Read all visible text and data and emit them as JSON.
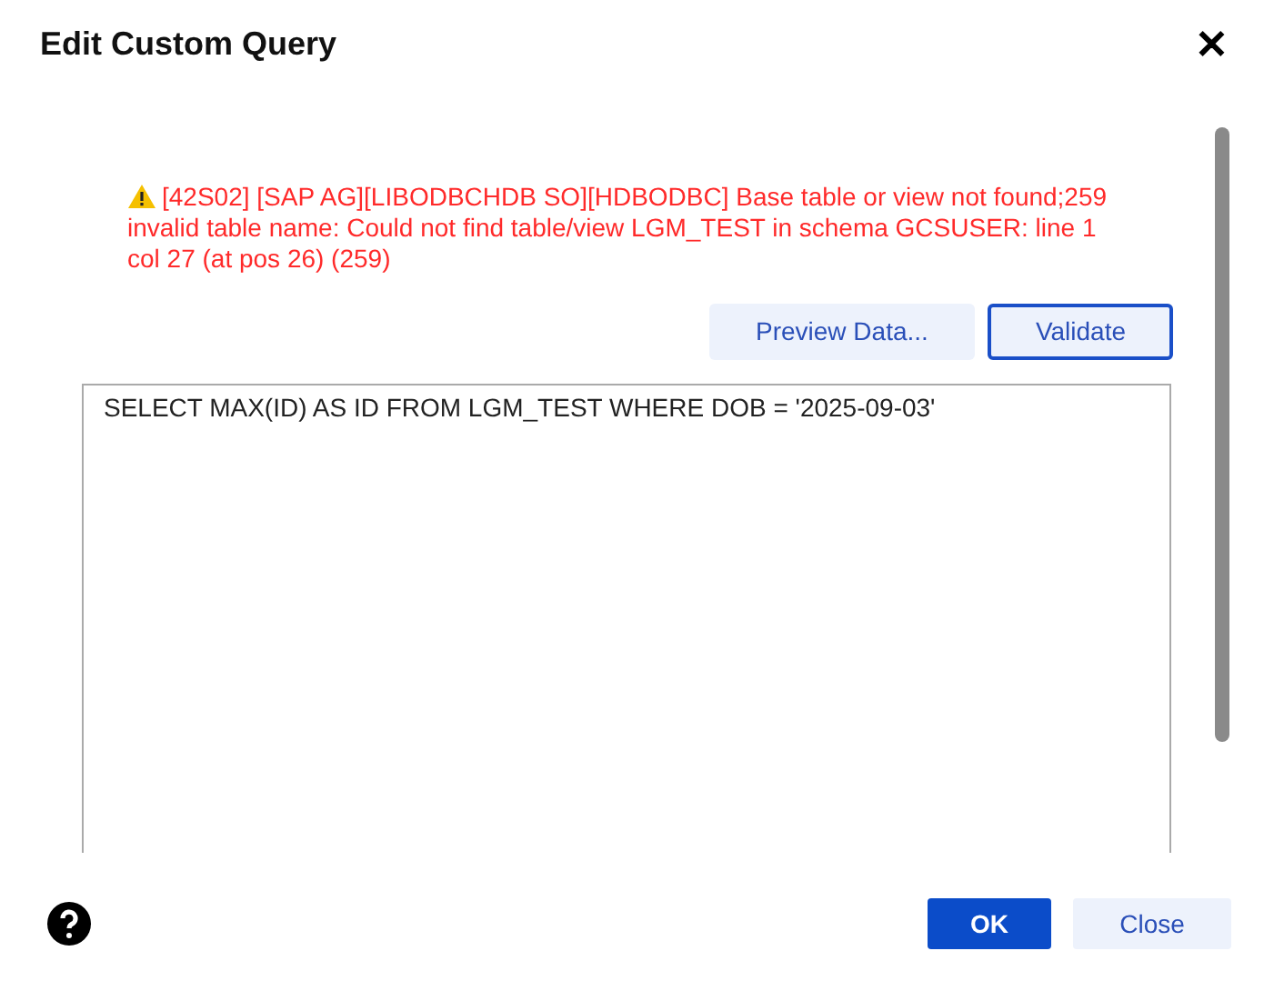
{
  "dialog": {
    "title": "Edit Custom Query",
    "close_label": "✕"
  },
  "error": {
    "message": "[42S02] [SAP AG][LIBODBCHDB SO][HDBODBC] Base table or view not found;259 invalid table name: Could not find table/view LGM_TEST in schema GCSUSER: line 1 col 27 (at pos 26) (259)"
  },
  "actions": [
    {
      "label": "Preview Data...",
      "focused": false
    },
    {
      "label": "Validate",
      "focused": true
    }
  ],
  "query": {
    "value": "SELECT MAX(ID) AS ID FROM LGM_TEST WHERE DOB = '2025-09-03'"
  },
  "footer_buttons": [
    {
      "label": "OK",
      "kind": "primary"
    },
    {
      "label": "Close",
      "kind": "secondary"
    }
  ]
}
